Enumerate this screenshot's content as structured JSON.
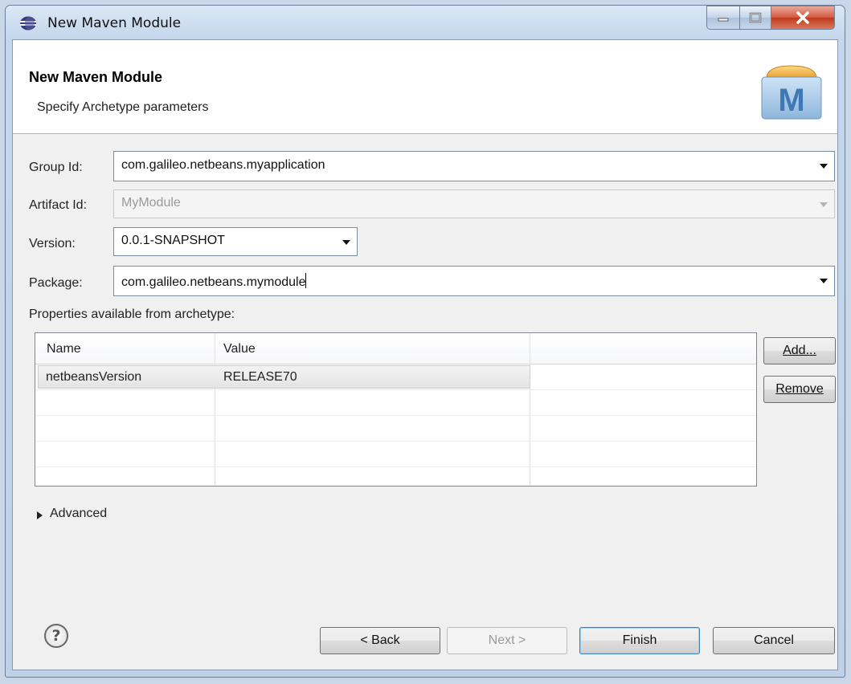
{
  "window": {
    "title": "New Maven Module"
  },
  "banner": {
    "title": "New Maven Module",
    "subtitle": "Specify Archetype parameters",
    "logo_letter": "M"
  },
  "form": {
    "group_id_label": "Group Id:",
    "group_id_value": "com.galileo.netbeans.myapplication",
    "artifact_id_label": "Artifact Id:",
    "artifact_id_value": "MyModule",
    "version_label": "Version:",
    "version_value": "0.0.1-SNAPSHOT",
    "package_label": "Package:",
    "package_value": "com.galileo.netbeans.mymodule"
  },
  "properties": {
    "label": "Properties available from archetype:",
    "columns": [
      "Name",
      "Value"
    ],
    "rows": [
      {
        "name": "netbeansVersion",
        "value": "RELEASE70"
      }
    ],
    "add_label": "Add...",
    "remove_label": "Remove"
  },
  "advanced": {
    "label": "Advanced"
  },
  "buttons": {
    "back": "< Back",
    "next": "Next >",
    "finish": "Finish",
    "cancel": "Cancel"
  },
  "icons": {
    "help": "help-icon",
    "title": "eclipse-icon",
    "logo": "maven-logo-icon",
    "expand": "triangle-right-icon"
  },
  "colors": {
    "default_button_border": "#3c7fb1",
    "close_button": "#c0391c",
    "titlebar": "#c5d7ec"
  }
}
